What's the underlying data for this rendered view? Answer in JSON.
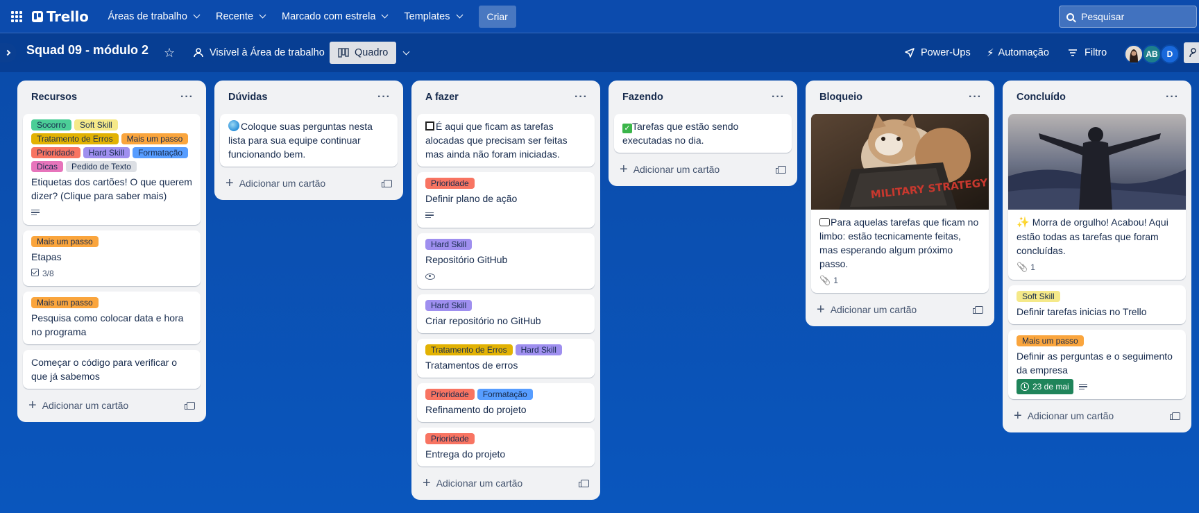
{
  "topnav": {
    "brand": "Trello",
    "menus": [
      "Áreas de trabalho",
      "Recente",
      "Marcado com estrela",
      "Templates"
    ],
    "create_label": "Criar",
    "search_placeholder": "Pesquisar"
  },
  "board": {
    "title": "Squad 09 - módulo 2",
    "visibility": "Visível à Área de trabalho",
    "view": "Quadro",
    "powerups": "Power-Ups",
    "automation": "Automação",
    "filter": "Filtro",
    "members": [
      "",
      "AB",
      "D"
    ]
  },
  "colors": {
    "Socorro": "#4bce97",
    "Soft Skill": "#f5e989",
    "Tratamento de Erros": "#e2b203",
    "Mais um passo": "#faa53d",
    "Prioridade": "#f87462",
    "Hard Skill": "#9f8fef",
    "Formatação": "#579dff",
    "Dicas": "#e774bb",
    "Pedido de Texto": "#dcdfe4"
  },
  "add_card_label": "Adicionar um cartão",
  "lists": [
    {
      "title": "Recursos",
      "cards": [
        {
          "labels": [
            "Socorro",
            "Soft Skill",
            "Tratamento de Erros",
            "Mais um passo",
            "Prioridade",
            "Hard Skill",
            "Formatação",
            "Dicas",
            "Pedido de Texto"
          ],
          "text": "Etiquetas dos cartões! O que querem dizer? (Clique para saber mais)",
          "desc": true
        },
        {
          "labels": [
            "Mais um passo"
          ],
          "text": "Etapas",
          "checklist": "3/8"
        },
        {
          "labels": [
            "Mais um passo"
          ],
          "text": "Pesquisa como colocar data e hora no programa"
        },
        {
          "labels": [],
          "text": "Começar o código para verificar o que já sabemos"
        }
      ]
    },
    {
      "title": "Dúvidas",
      "cards": [
        {
          "labels": [],
          "emoji": "wave",
          "text": "Coloque suas perguntas nesta lista para sua equipe continuar funcionando bem."
        }
      ]
    },
    {
      "title": "A fazer",
      "cards": [
        {
          "labels": [],
          "emoji": "box",
          "text": "É aqui que ficam as tarefas alocadas que precisam ser feitas mas ainda não foram iniciadas."
        },
        {
          "labels": [
            "Prioridade"
          ],
          "text": "Definir plano de ação",
          "desc": true
        },
        {
          "labels": [
            "Hard Skill"
          ],
          "text": "Repositório GitHub",
          "watch": true
        },
        {
          "labels": [
            "Hard Skill"
          ],
          "text": "Criar repositório no GitHub"
        },
        {
          "labels": [
            "Tratamento de Erros",
            "Hard Skill"
          ],
          "text": "Tratamentos de erros"
        },
        {
          "labels": [
            "Prioridade",
            "Formatação"
          ],
          "text": "Refinamento do projeto"
        },
        {
          "labels": [
            "Prioridade"
          ],
          "text": "Entrega do projeto"
        }
      ]
    },
    {
      "title": "Fazendo",
      "cards": [
        {
          "labels": [],
          "emoji": "check",
          "text": "Tarefas que estão sendo executadas no dia."
        }
      ]
    },
    {
      "title": "Bloqueio",
      "cards": [
        {
          "labels": [],
          "cover": "cat",
          "cover_book_text": "MILITARY STRATEGY",
          "emoji": "bubble",
          "text": "Para aquelas tarefas que ficam no limbo: estão tecnicamente feitas, mas esperando algum próximo passo.",
          "attachments": "1"
        }
      ]
    },
    {
      "title": "Concluído",
      "cards": [
        {
          "labels": [],
          "cover": "person",
          "emoji": "spark",
          "text": "Morra de orgulho! Acabou! Aqui estão todas as tarefas que foram concluídas.",
          "attachments": "1"
        },
        {
          "labels": [
            "Soft Skill"
          ],
          "text": "Definir tarefas inicias no Trello"
        },
        {
          "labels": [
            "Mais um passo"
          ],
          "text": "Definir as perguntas e o seguimento da empresa",
          "due": "23 de mai",
          "desc": true
        }
      ]
    }
  ]
}
